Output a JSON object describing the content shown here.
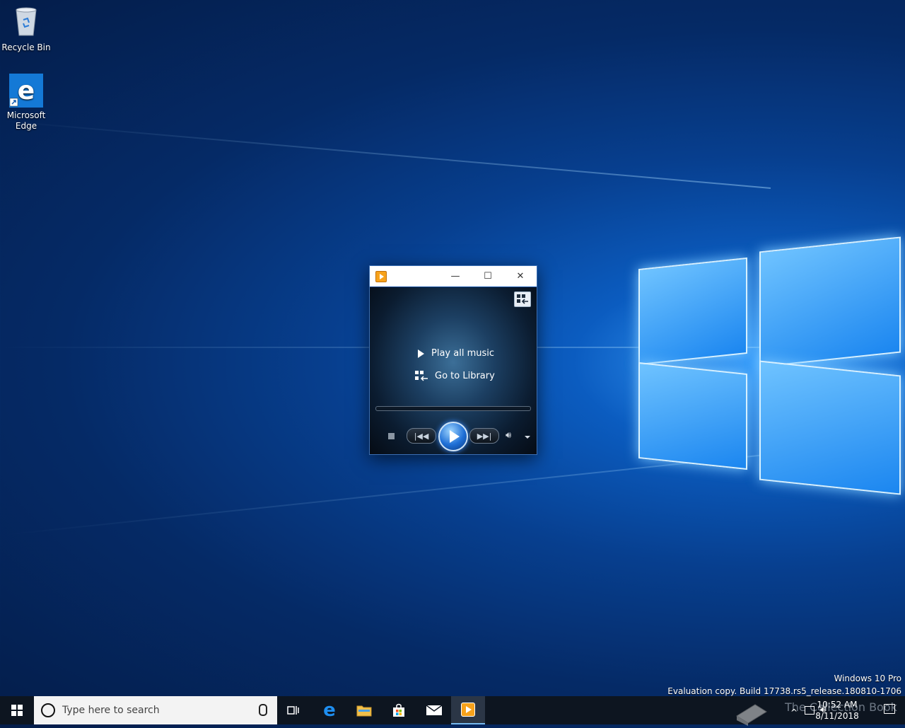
{
  "desktop": {
    "icons": [
      {
        "label": "Recycle Bin"
      },
      {
        "label": "Microsoft\nEdge"
      }
    ]
  },
  "wmp": {
    "title_buttons": {
      "minimize": "—",
      "maximize": "☐",
      "close": "✕"
    },
    "links": {
      "play_all": "Play all music",
      "go_to_library": "Go to Library"
    }
  },
  "watermark": {
    "line1": "Windows 10 Pro",
    "line2": "Evaluation copy. Build 17738.rs5_release.180810-1706"
  },
  "taskbar": {
    "search_placeholder": "Type here to search",
    "clock_time": "10:52 AM",
    "clock_date": "8/11/2018",
    "overlay_text": "The Collection Book"
  },
  "colors": {
    "accent": "#76b9ed",
    "taskbar": "#0d1520"
  }
}
